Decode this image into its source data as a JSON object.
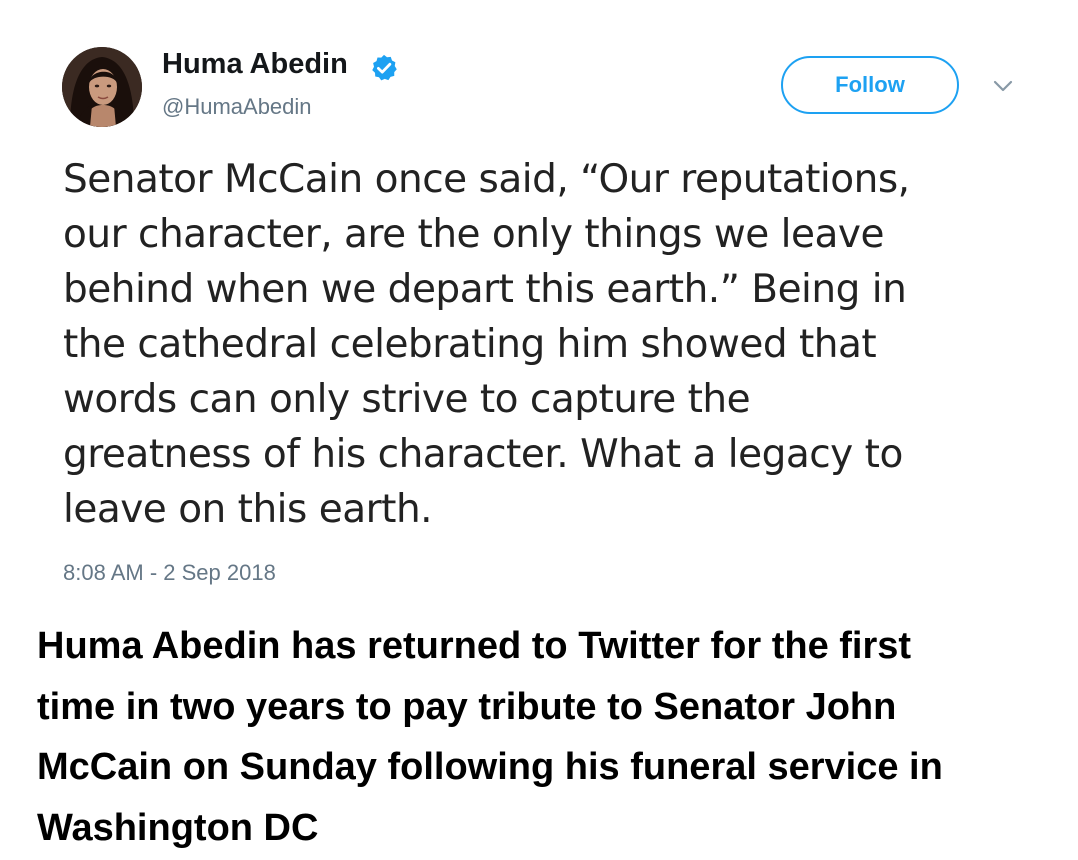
{
  "tweet": {
    "author": {
      "display_name": "Huma Abedin",
      "handle": "@HumaAbedin",
      "verified_icon": "verified-badge-icon",
      "avatar_icon": "avatar-photo"
    },
    "follow_label": "Follow",
    "menu_icon": "chevron-down-icon",
    "text_lines": [
      "Senator McCain once said, “Our reputations,",
      "our character, are the only things we leave",
      "behind when we depart this earth.” Being in",
      "the cathedral celebrating him showed that",
      "words can only strive to capture the",
      "greatness of his character. What a legacy to",
      "leave on this earth."
    ],
    "timestamp": "8:08 AM - 2 Sep 2018"
  },
  "caption": {
    "lines": [
      "Huma Abedin has returned to Twitter for the first",
      "time in two years to pay tribute to Senator John",
      "McCain on Sunday following his funeral service in",
      "Washington DC"
    ]
  },
  "colors": {
    "accent": "#1da1f2",
    "secondary_text": "#657786",
    "primary_text": "#14171a"
  }
}
